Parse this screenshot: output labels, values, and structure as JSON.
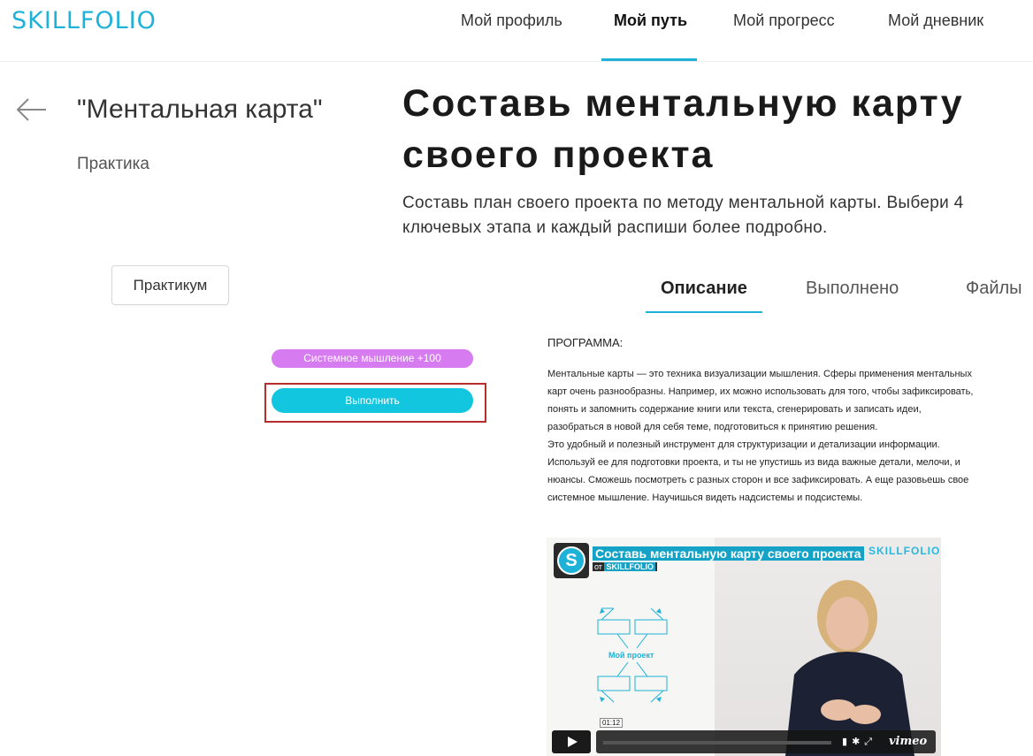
{
  "header": {
    "logo": "SKILLFOLIO",
    "nav": [
      "Мой профиль",
      "Мой путь",
      "Мой прогресс",
      "Мой дневник"
    ],
    "active_nav": "Мой путь"
  },
  "lesson": {
    "title": "\"Ментальная карта\"",
    "type": "Практика",
    "practicum_button": "Практикум",
    "skill_badge": "Системное мышление +100",
    "complete_button": "Выполнить"
  },
  "main": {
    "title": "Составь ментальную карту своего проекта",
    "subtitle": "Составь план своего проекта по методу ментальной карты. Выбери 4 ключевых этапа и каждый распиши более подробно.",
    "tabs": [
      "Описание",
      "Выполнено",
      "Файлы"
    ],
    "active_tab": "Описание",
    "program_heading": "ПРОГРАММА:",
    "program_lines": [
      "Ментальные карты — это техника визуализации мышления. Сферы применения ментальных",
      "карт очень разнообразны. Например, их можно использовать для того, чтобы зафиксировать,",
      "понять и запомнить содержание книги или текста, сгенерировать и записать идеи,",
      "разобраться в новой для себя теме, подготовиться к принятию решения.",
      "Это удобный и полезный инструмент для структуризации и детализации информации.",
      "Используй ее для подготовки проекта, и ты не упустишь из вида важные детали, мелочи, и",
      "нюансы. Сможешь посмотреть с разных сторон и все зафиксировать. А еще разовьешь свое",
      "системное мышление. Научишься видеть надсистемы и подсистемы."
    ]
  },
  "video": {
    "title": "Составь ментальную карту своего проекта",
    "by_prefix": "от",
    "by_brand": "SKILLFOLIO",
    "brand_watermark": "SKILLFOLIO",
    "map_label": "Мой проект",
    "time": "01:12",
    "player": "vimeo",
    "accent": "#14a3c6"
  },
  "colors": {
    "brand": "#1fb2d8",
    "skill_badge": "#d67cf0",
    "complete_button": "#12c6e0",
    "highlight_frame": "#b52d2d"
  }
}
